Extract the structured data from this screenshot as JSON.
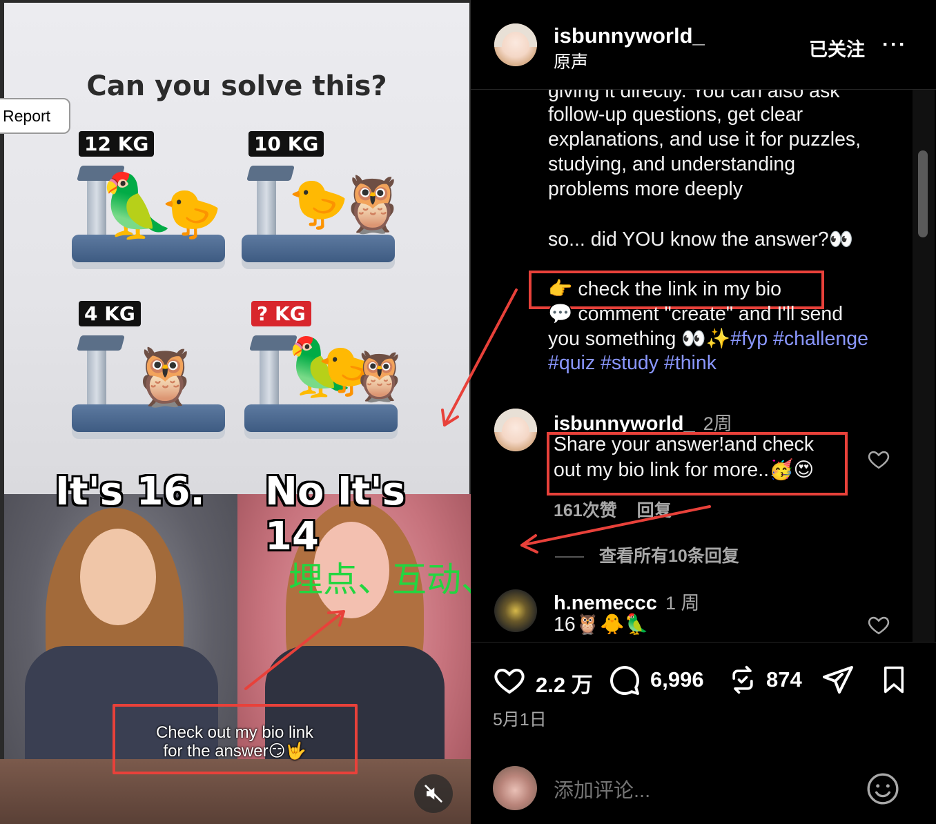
{
  "media": {
    "report_label": "Report",
    "puzzle_title": "Can you solve this?",
    "scales": [
      {
        "tag": "12 KG",
        "birds": [
          "🦜",
          "🐤"
        ]
      },
      {
        "tag": "10 KG",
        "birds": [
          "🐤",
          "🦉"
        ]
      },
      {
        "tag": "4 KG",
        "birds": [
          "🦉"
        ]
      },
      {
        "tag": "? KG",
        "birds": [
          "🦜",
          "🐤",
          "🦉"
        ]
      }
    ],
    "overlay_left": "It's 16.",
    "overlay_right": "No It's 14",
    "video_caption_line1": "Check out my bio link",
    "video_caption_line2": "for the answer😏🤟",
    "annotation_text": "埋点、互动、引导",
    "annotation_color": "#22d640",
    "highlight_color": "#e8413a"
  },
  "header": {
    "username": "isbunnyworld_",
    "subtitle": "原声",
    "follow_status": "已关注",
    "more_label": "···"
  },
  "caption": {
    "lines": [
      "giving it directly. You can also ask",
      "follow-up questions, get clear",
      "explanations, and use it for puzzles,",
      "studying, and understanding",
      "problems more deeply",
      "so... did YOU know the answer?👀",
      "👉 check the link in my bio",
      "💬 comment \"create\" and I'll send",
      "you something 👀✨"
    ],
    "hashtags_line1": "#fyp #challenge",
    "hashtags_line2": "#quiz #study #think"
  },
  "comments": [
    {
      "username": "isbunnyworld_",
      "time": "2周",
      "text_line1": "Share your answer!and check",
      "text_line2": "out my bio link for more..🥳😍",
      "likes": "161次赞",
      "reply_label": "回复",
      "view_replies": "查看所有10条回复"
    },
    {
      "username": "h.nemeccc",
      "time": "1 周",
      "text": "16🦉🐥🦜"
    }
  ],
  "actions": {
    "likes": "2.2 万",
    "comments": "6,996",
    "reposts": "874",
    "date": "5月1日"
  },
  "comment_input": {
    "placeholder": "添加评论..."
  }
}
